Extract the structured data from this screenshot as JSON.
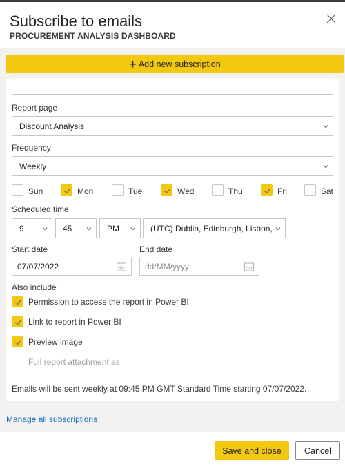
{
  "dialog": {
    "title": "Subscribe to emails",
    "subtitle": "PROCUREMENT ANALYSIS DASHBOARD"
  },
  "toolbar": {
    "add_icon": "plus-icon",
    "add_label": "Add new subscription"
  },
  "form": {
    "report_page": {
      "label": "Report page",
      "value": "Discount Analysis"
    },
    "frequency": {
      "label": "Frequency",
      "value": "Weekly"
    },
    "days": [
      {
        "label": "Sun",
        "checked": false
      },
      {
        "label": "Mon",
        "checked": true
      },
      {
        "label": "Tue",
        "checked": false
      },
      {
        "label": "Wed",
        "checked": true
      },
      {
        "label": "Thu",
        "checked": false
      },
      {
        "label": "Fri",
        "checked": true
      },
      {
        "label": "Sat",
        "checked": false
      }
    ],
    "scheduled_time": {
      "label": "Scheduled time",
      "hour": "9",
      "minute": "45",
      "ampm": "PM",
      "timezone": "(UTC) Dublin, Edinburgh, Lisbon, L"
    },
    "start_date": {
      "label": "Start date",
      "value": "07/07/2022"
    },
    "end_date": {
      "label": "End date",
      "placeholder": "dd/MM/yyyy"
    },
    "also_include": {
      "label": "Also include",
      "options": [
        {
          "label": "Permission to access the report in Power BI",
          "checked": true,
          "disabled": false
        },
        {
          "label": "Link to report in Power BI",
          "checked": true,
          "disabled": false
        },
        {
          "label": "Preview image",
          "checked": true,
          "disabled": false
        },
        {
          "label": "Full report attachment as",
          "checked": false,
          "disabled": true
        }
      ]
    },
    "summary": "Emails will be sent weekly at 09:45 PM GMT Standard Time starting 07/07/2022."
  },
  "links": {
    "manage": "Manage all subscriptions"
  },
  "footer": {
    "save_label": "Save and close",
    "cancel_label": "Cancel"
  },
  "colors": {
    "accent": "#f2c811",
    "link": "#0f6cbd",
    "panel_bg": "#f3f2f1"
  }
}
